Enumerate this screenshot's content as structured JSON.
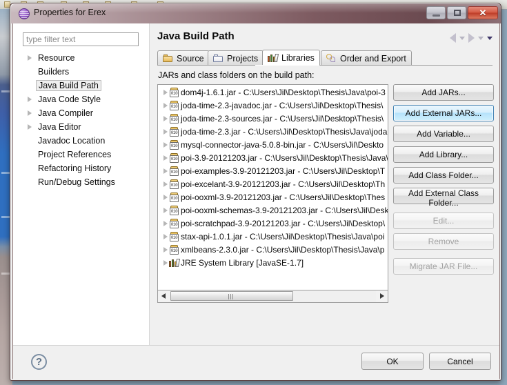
{
  "window": {
    "title": "Properties for Erex",
    "app_icon": "eclipse-sphere-icon",
    "buttons": {
      "minimize": "minimize-icon",
      "maximize": "maximize-icon",
      "close": "✕"
    }
  },
  "filter": {
    "placeholder": "type filter text",
    "value": ""
  },
  "tree": {
    "items": [
      {
        "label": "Resource",
        "expandable": true,
        "selected": false
      },
      {
        "label": "Builders",
        "expandable": false,
        "selected": false
      },
      {
        "label": "Java Build Path",
        "expandable": false,
        "selected": true
      },
      {
        "label": "Java Code Style",
        "expandable": true,
        "selected": false
      },
      {
        "label": "Java Compiler",
        "expandable": true,
        "selected": false
      },
      {
        "label": "Java Editor",
        "expandable": true,
        "selected": false
      },
      {
        "label": "Javadoc Location",
        "expandable": false,
        "selected": false
      },
      {
        "label": "Project References",
        "expandable": false,
        "selected": false
      },
      {
        "label": "Refactoring History",
        "expandable": false,
        "selected": false
      },
      {
        "label": "Run/Debug Settings",
        "expandable": false,
        "selected": false
      }
    ]
  },
  "content": {
    "page_title": "Java Build Path",
    "nav": {
      "back_icon": "arrow-left-icon",
      "back_menu_icon": "chevron-down-icon",
      "forward_icon": "arrow-right-icon",
      "forward_menu_icon": "chevron-down-icon",
      "history_menu_icon": "chevron-down-icon"
    },
    "tabs": [
      {
        "label": "Source",
        "icon": "source-folder-icon",
        "active": false
      },
      {
        "label": "Projects",
        "icon": "project-folder-icon",
        "active": false
      },
      {
        "label": "Libraries",
        "icon": "libraries-books-icon",
        "active": true
      },
      {
        "label": "Order and Export",
        "icon": "order-export-icon",
        "active": false
      }
    ],
    "libraries": {
      "caption": "JARs and class folders on the build path:",
      "entries": [
        {
          "icon": "jar-icon",
          "text": "dom4j-1.6.1.jar - C:\\Users\\Jil\\Desktop\\Thesis\\Java\\poi-3"
        },
        {
          "icon": "jar-icon",
          "text": "joda-time-2.3-javadoc.jar - C:\\Users\\Jil\\Desktop\\Thesis\\"
        },
        {
          "icon": "jar-icon",
          "text": "joda-time-2.3-sources.jar - C:\\Users\\Jil\\Desktop\\Thesis\\"
        },
        {
          "icon": "jar-icon",
          "text": "joda-time-2.3.jar - C:\\Users\\Jil\\Desktop\\Thesis\\Java\\joda"
        },
        {
          "icon": "jar-icon",
          "text": "mysql-connector-java-5.0.8-bin.jar - C:\\Users\\Jil\\Deskto"
        },
        {
          "icon": "jar-icon",
          "text": "poi-3.9-20121203.jar - C:\\Users\\Jil\\Desktop\\Thesis\\Java\\"
        },
        {
          "icon": "jar-icon",
          "text": "poi-examples-3.9-20121203.jar - C:\\Users\\Jil\\Desktop\\T"
        },
        {
          "icon": "jar-icon",
          "text": "poi-excelant-3.9-20121203.jar - C:\\Users\\Jil\\Desktop\\Th"
        },
        {
          "icon": "jar-icon",
          "text": "poi-ooxml-3.9-20121203.jar - C:\\Users\\Jil\\Desktop\\Thes"
        },
        {
          "icon": "jar-icon",
          "text": "poi-ooxml-schemas-3.9-20121203.jar - C:\\Users\\Jil\\Desk"
        },
        {
          "icon": "jar-icon",
          "text": "poi-scratchpad-3.9-20121203.jar - C:\\Users\\Jil\\Desktop\\"
        },
        {
          "icon": "jar-icon",
          "text": "stax-api-1.0.1.jar - C:\\Users\\Jil\\Desktop\\Thesis\\Java\\poi"
        },
        {
          "icon": "jar-icon",
          "text": "xmlbeans-2.3.0.jar - C:\\Users\\Jil\\Desktop\\Thesis\\Java\\p"
        },
        {
          "icon": "jre-icon",
          "text": "JRE System Library [JavaSE-1.7]"
        }
      ],
      "scrollbar": {
        "left_arrow_icon": "scroll-left-icon",
        "right_arrow_icon": "scroll-right-icon",
        "grip_icon": "scroll-grip-icon"
      }
    },
    "action_buttons": [
      {
        "label": "Add JARs...",
        "state": "normal"
      },
      {
        "label": "Add External JARs...",
        "state": "focused"
      },
      {
        "label": "Add Variable...",
        "state": "normal"
      },
      {
        "label": "Add Library...",
        "state": "normal"
      },
      {
        "label": "Add Class Folder...",
        "state": "normal"
      },
      {
        "label": "Add External Class Folder...",
        "state": "normal"
      },
      {
        "label": "Edit...",
        "state": "disabled"
      },
      {
        "label": "Remove",
        "state": "disabled"
      },
      {
        "label": "Migrate JAR File...",
        "state": "disabled"
      }
    ]
  },
  "footer": {
    "help_label": "?",
    "ok_label": "OK",
    "cancel_label": "Cancel"
  }
}
